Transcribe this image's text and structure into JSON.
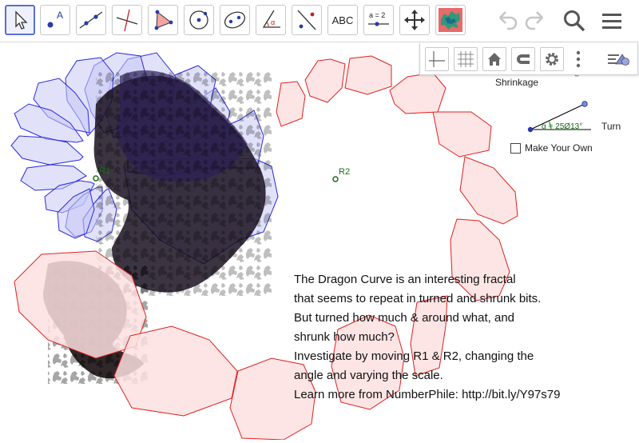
{
  "toolbar": {
    "tools": [
      {
        "name": "move-tool",
        "label": ""
      },
      {
        "name": "point-tool",
        "label": "A"
      },
      {
        "name": "line-tool",
        "label": ""
      },
      {
        "name": "perpendicular-line-tool",
        "label": ""
      },
      {
        "name": "polygon-tool",
        "label": ""
      },
      {
        "name": "circle-tool",
        "label": ""
      },
      {
        "name": "conic-tool",
        "label": ""
      },
      {
        "name": "angle-tool",
        "label": "α"
      },
      {
        "name": "reflect-tool",
        "label": ""
      },
      {
        "name": "text-tool",
        "label": "ABC"
      },
      {
        "name": "slider-tool",
        "label": "a = 2"
      },
      {
        "name": "move-graphics-view-tool",
        "label": ""
      },
      {
        "name": "custom-tool",
        "label": ""
      }
    ],
    "undo_icon": "undo-icon",
    "redo_icon": "redo-icon",
    "search_icon": "search-icon",
    "menu_icon": "hamburger-menu-icon"
  },
  "stylebar": {
    "buttons": [
      "axes-icon",
      "grid-icon",
      "home-icon",
      "magnet-icon",
      "gear-icon",
      "more-vertical-icon",
      "style-bar-toggle-icon"
    ]
  },
  "controls": {
    "shrinkage_label": "Shrinkage",
    "turn_label": "Turn",
    "angle_value": "α = 25Ø13°",
    "make_your_own_label": "Make Your Own",
    "make_your_own_checked": false
  },
  "points": {
    "r1": "R1",
    "r2": "R2"
  },
  "description": {
    "lines": [
      "The Dragon Curve is an interesting fractal",
      "that seems to repeat in turned and shrunk bits.",
      "But turned how much & around what, and",
      "shrunk how much?",
      "Investigate by moving R1 & R2, changing the",
      "angle and varying the scale.",
      "Learn more from NumberPhile: http://bit.ly/Y97s79"
    ]
  },
  "colors": {
    "blue_stroke": "#2a2ae0",
    "blue_fill": "#c8c8f5",
    "red_stroke": "#e02020",
    "red_fill": "#fde0e0",
    "fractal": "#000000",
    "accent": "#5b6fd1"
  }
}
